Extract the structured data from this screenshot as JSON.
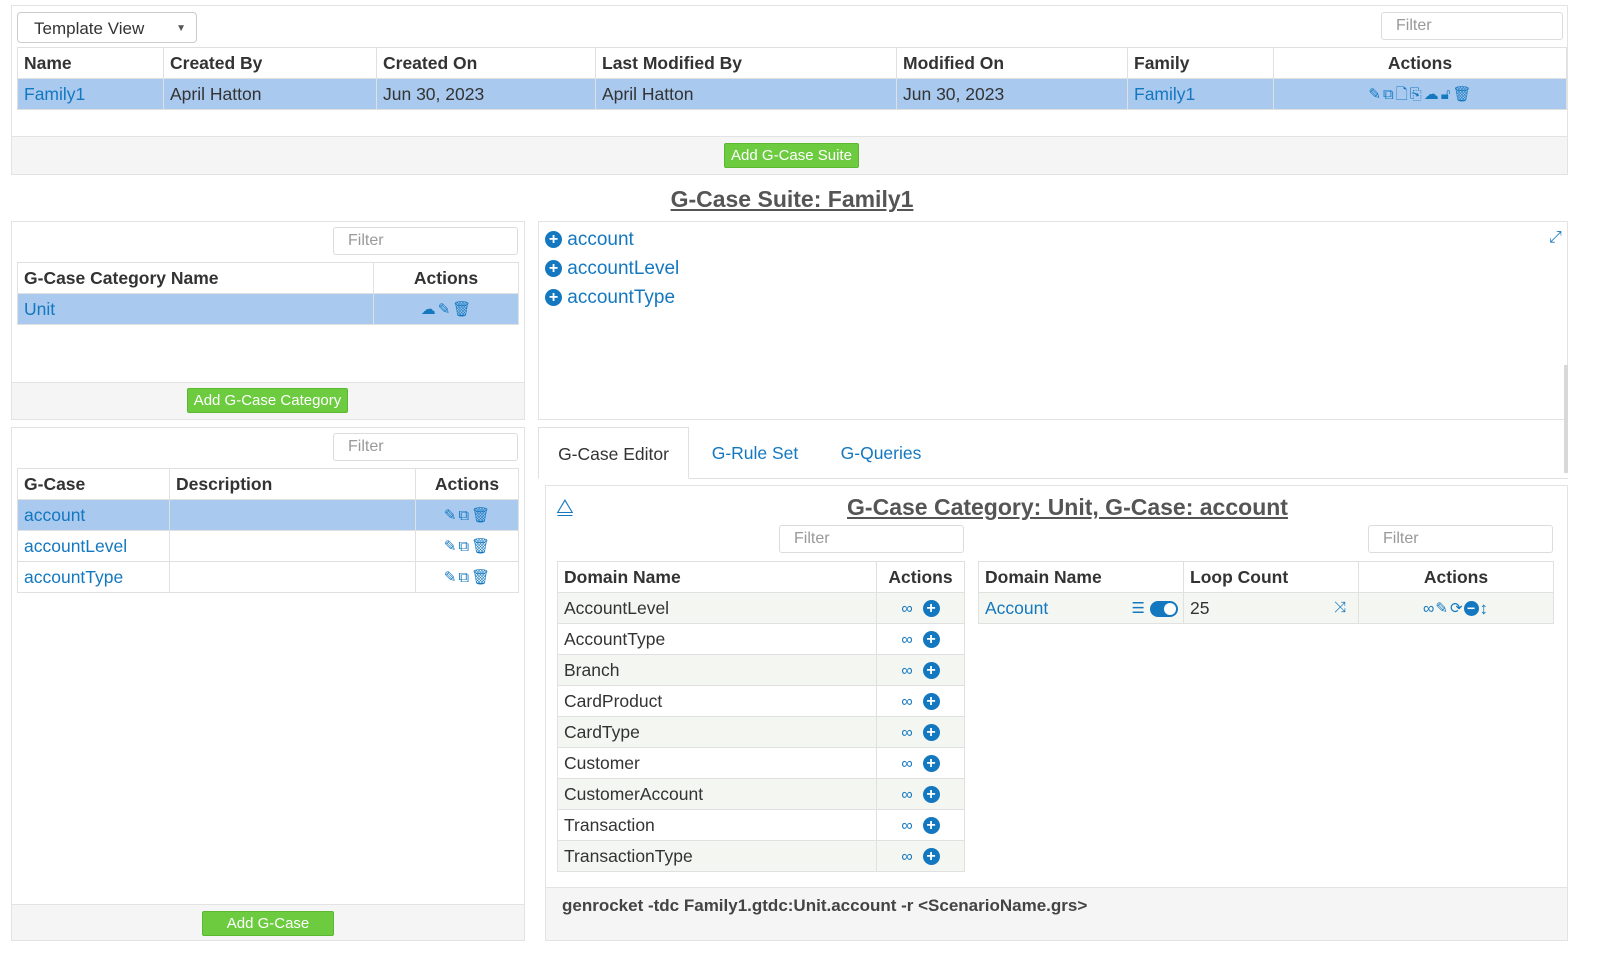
{
  "top": {
    "view_select": "Template View",
    "filter_placeholder": "Filter",
    "columns": [
      "Name",
      "Created By",
      "Created On",
      "Last Modified By",
      "Modified On",
      "Family",
      "Actions"
    ],
    "rows": [
      {
        "name": "Family1",
        "created_by": "April Hatton",
        "created_on": "Jun 30, 2023",
        "last_modified_by": "April Hatton",
        "modified_on": "Jun 30, 2023",
        "family": "Family1"
      }
    ],
    "add_button": "Add G-Case Suite"
  },
  "suite_title": "G-Case Suite: Family1",
  "category_panel": {
    "filter_placeholder": "Filter",
    "columns": [
      "G-Case Category Name",
      "Actions"
    ],
    "rows": [
      {
        "name": "Unit"
      }
    ],
    "add_button": "Add G-Case Category"
  },
  "gcase_panel": {
    "filter_placeholder": "Filter",
    "columns": [
      "G-Case",
      "Description",
      "Actions"
    ],
    "rows": [
      {
        "name": "account",
        "description": ""
      },
      {
        "name": "accountLevel",
        "description": ""
      },
      {
        "name": "accountType",
        "description": ""
      }
    ],
    "add_button": "Add G-Case"
  },
  "tree": {
    "items": [
      "account",
      "accountLevel",
      "accountType"
    ]
  },
  "tabs": [
    "G-Case Editor",
    "G-Rule Set",
    "G-Queries"
  ],
  "editor": {
    "title": "G-Case Category: Unit, G-Case: account",
    "left_filter": "Filter",
    "right_filter": "Filter",
    "domain_columns": [
      "Domain Name",
      "Actions"
    ],
    "domains": [
      "AccountLevel",
      "AccountType",
      "Branch",
      "CardProduct",
      "CardType",
      "Customer",
      "CustomerAccount",
      "Transaction",
      "TransactionType"
    ],
    "selected_columns": [
      "Domain Name",
      "Loop Count",
      "Actions"
    ],
    "selected": [
      {
        "name": "Account",
        "loop_count": "25"
      }
    ],
    "command": "genrocket -tdc Family1.gtdc:Unit.account -r <ScenarioName.grs>"
  },
  "colors": {
    "accent": "#1478c0",
    "selected_row": "#a9c9ef",
    "green_button": "#6ccb3f"
  }
}
